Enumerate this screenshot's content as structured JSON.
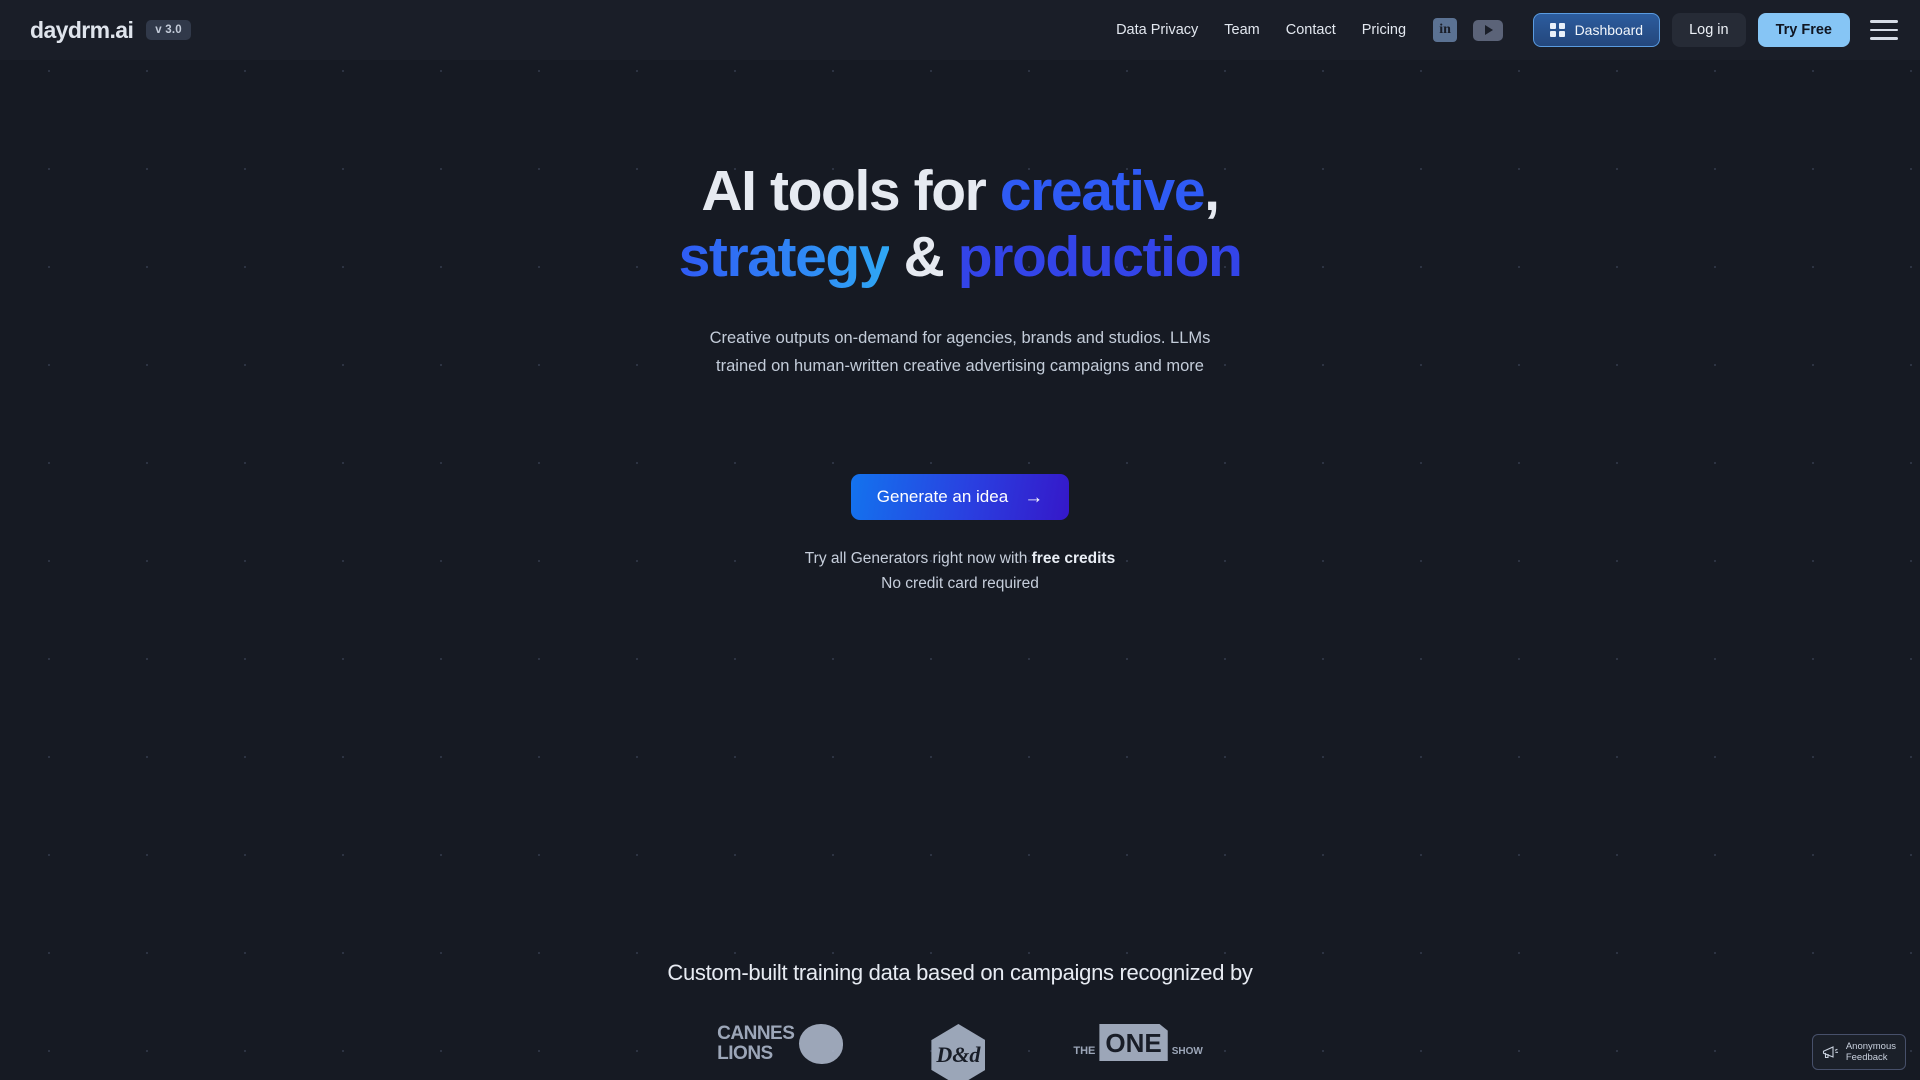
{
  "header": {
    "brand": "daydrm.ai",
    "version_badge": "v 3.0",
    "nav_links": [
      {
        "label": "Data Privacy"
      },
      {
        "label": "Team"
      },
      {
        "label": "Contact"
      },
      {
        "label": "Pricing"
      }
    ],
    "social": [
      {
        "name": "linkedin-icon",
        "glyph": "in"
      },
      {
        "name": "youtube-icon",
        "glyph": "play"
      }
    ],
    "dashboard_label": "Dashboard",
    "login_label": "Log in",
    "try_free_label": "Try Free",
    "menu_icon": "hamburger-icon",
    "accent_blue": "#2F5BF5",
    "try_free_bg": "#86C5F5"
  },
  "hero": {
    "heading_line1_plain": "AI tools for ",
    "heading_creative": "creative",
    "heading_comma": ",",
    "heading_strategy": "strategy",
    "heading_amp": " & ",
    "heading_production": "production",
    "subheading": "Creative outputs on-demand for agencies, brands and studios. LLMs trained on human-written creative advertising campaigns and more",
    "cta_label": "Generate an idea",
    "cta_arrow": "→",
    "note_prefix": "Try all Generators right now with ",
    "note_strong": "free credits",
    "note_secondary": "No credit card required"
  },
  "awards": {
    "title": "Custom-built training data based on campaigns recognized by",
    "logos": [
      {
        "name": "cannes-lions-logo",
        "line1": "CANNES",
        "line2": "LIONS"
      },
      {
        "name": "dad-logo",
        "text": "D&AD",
        "mark": "D&d"
      },
      {
        "name": "one-show-logo",
        "the": "THE",
        "one": "ONE",
        "show": "SHOW"
      }
    ]
  },
  "feedback_widget": {
    "line1": "Anonymous",
    "line2": "Feedback",
    "icon": "megaphone-icon"
  }
}
